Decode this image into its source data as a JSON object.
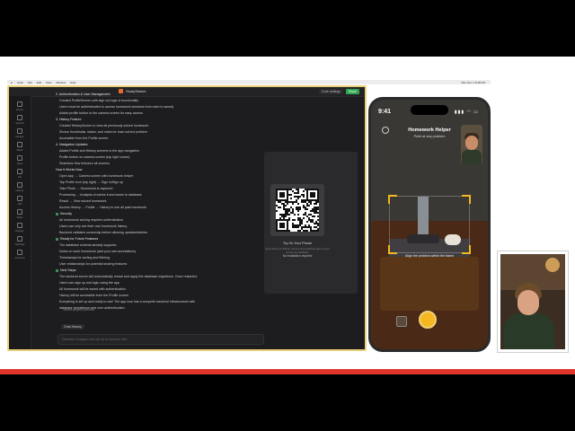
{
  "menubar": {
    "items": [
      "Code",
      "File",
      "Edit",
      "View",
      "Window",
      "Help"
    ],
    "right": "Mon Nov 1 8:48 PM"
  },
  "ide": {
    "app_title": "StudySketch",
    "code_settings": "Code settings",
    "share": "Share",
    "rail": [
      "Home",
      "Search",
      "Design",
      "Build",
      "Files",
      "Git",
      "History",
      "API",
      "Tests",
      "Deploy",
      "Settings",
      "Account"
    ],
    "lines": [
      {
        "t": "2. Authentication & User Management",
        "h": true
      },
      {
        "t": "Created ProfileScreen with sign out logic & functionality"
      },
      {
        "t": "Users must be authenticated to access homework sessions from each to saved)"
      },
      {
        "t": "Added profile button to the camera screen for easy access"
      },
      {
        "t": "3. History Feature",
        "h": true
      },
      {
        "t": "Created HistoryScreen to view all previously solved homework"
      },
      {
        "t": "Shows thumbnails, status, and notes for each solved problem"
      },
      {
        "t": "Accessible from the Profile screen"
      },
      {
        "t": "4. Navigation Updates",
        "h": true
      },
      {
        "t": "Added Profile and History screens to the app navigation"
      },
      {
        "t": "Profile button on camera screen (top right corner)"
      },
      {
        "t": "Seamless flow between all screens"
      },
      {
        "t": "How It Works Now",
        "h": true
      },
      {
        "t": "Open App → Camera screen with homework helper"
      },
      {
        "t": "Tap Profile Icon (top right) → Sign in/Sign up"
      },
      {
        "t": "Take Photo → Homework is captured"
      },
      {
        "t": "Processing → Analysis of solves it and saves to database"
      },
      {
        "t": "Result → View solved homework"
      },
      {
        "t": "Access History → Profile → History to see all past homework"
      },
      {
        "t": "Security",
        "h": true,
        "c": true
      },
      {
        "t": "All homework solving requires authentication"
      },
      {
        "t": "Users can only see their own homework history"
      },
      {
        "t": "Backend validates ownership before allowing updates/deletes"
      },
      {
        "t": "Ready for Future Features",
        "h": true,
        "c": true
      },
      {
        "t": "The database schema already supports:"
      },
      {
        "t": "Notes on each homework (add your own annotations)"
      },
      {
        "t": "Timestamps for sorting and filtering"
      },
      {
        "t": "User relationships for potential sharing features"
      },
      {
        "t": "Next Steps",
        "h": true,
        "c": true
      },
      {
        "t": "The backend server will automatically restart and apply the database migrations. Once restarted:"
      },
      {
        "t": "Users can sign up and login using the app"
      },
      {
        "t": "All homework will be saved with authentication"
      },
      {
        "t": "History will be accessible from the Profile screen"
      },
      {
        "t": "Everything is set up and ready to use! The app now has a complete backend infrastructure with"
      },
      {
        "t": "database persistence and user authentication."
      }
    ],
    "project_note": "Saved project preview",
    "chat_history": "Chat History",
    "chat_placeholder": "Describe changes and use @ to mention files"
  },
  "qr": {
    "title": "Try On Your Phone",
    "desc": "Scan with your iPhone camera and install the app on your device via TestFlight",
    "note": "No installation required"
  },
  "phone": {
    "time": "9:41",
    "status": "▮▮▮ ◠ ▭",
    "title": "Homework Helper",
    "subtitle": "Point at any problem",
    "hint": "Align the problem within the frame"
  }
}
